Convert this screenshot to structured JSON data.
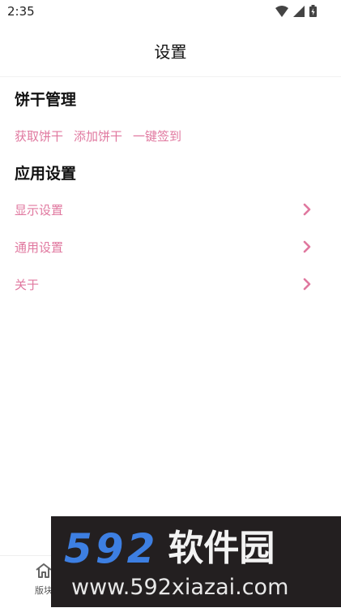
{
  "status_bar": {
    "time": "2:35"
  },
  "app_bar": {
    "title": "设置"
  },
  "cookie_section": {
    "title": "饼干管理",
    "actions": [
      "获取饼干",
      "添加饼干",
      "一键签到"
    ]
  },
  "app_section": {
    "title": "应用设置",
    "items": [
      "显示设置",
      "通用设置",
      "关于"
    ]
  },
  "bottom_nav": {
    "items": [
      {
        "label": "版块",
        "icon": "home-icon"
      }
    ]
  },
  "watermark": {
    "brand_number": "592",
    "brand_text": "软件园",
    "url": "www.592xiazai.com"
  },
  "colors": {
    "accent": "#e0789f",
    "watermark_blue": "#3d7fe2",
    "watermark_bg": "#231f20"
  }
}
